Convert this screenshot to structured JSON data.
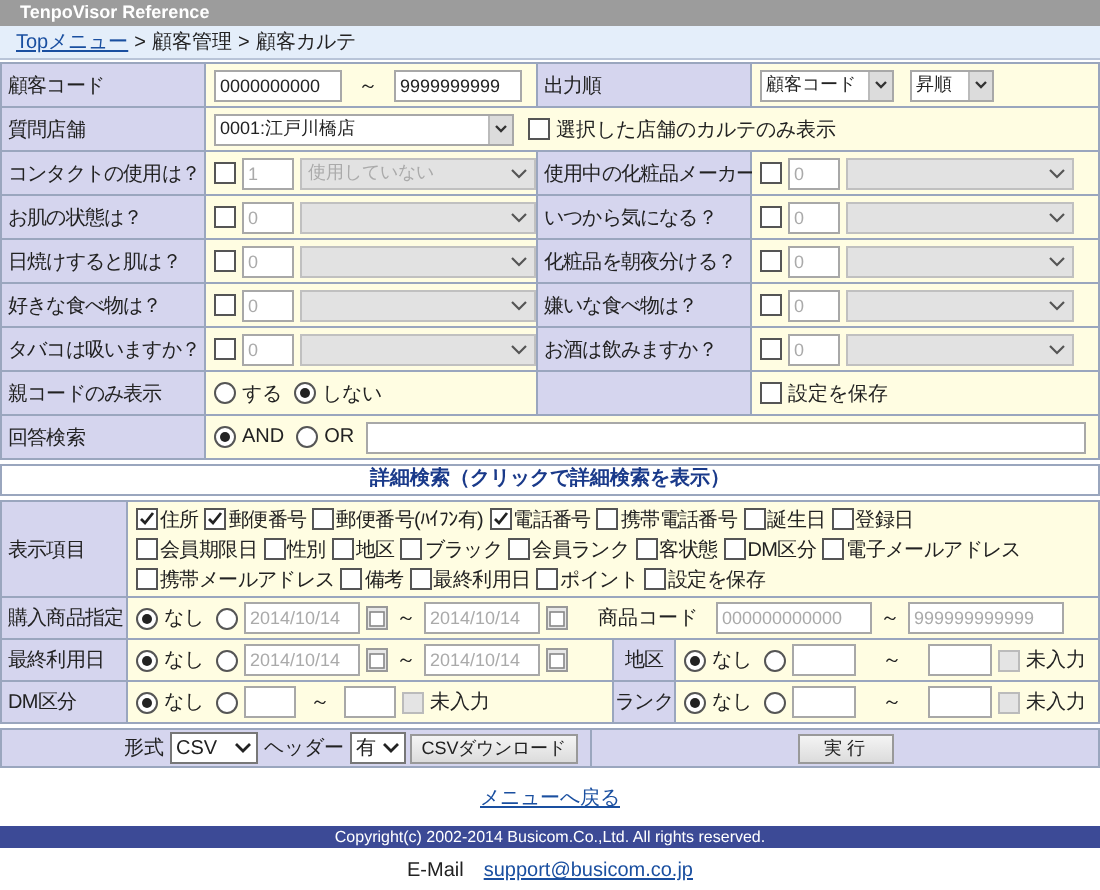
{
  "title": "TenpoVisor Reference",
  "breadcrumb": {
    "separator": ">",
    "items": [
      {
        "text": "Topメニュー",
        "link": true
      },
      {
        "text": "顧客管理",
        "link": false
      },
      {
        "text": "顧客カルテ",
        "link": false
      }
    ]
  },
  "customer_code": {
    "label": "顧客コード",
    "from": "0000000000",
    "tilde": "～",
    "to": "9999999999"
  },
  "output_order": {
    "label": "出力順",
    "sort_key": "顧客コード",
    "direction": "昇順"
  },
  "store": {
    "label": "質問店舗",
    "value": "0001:江戸川橋店",
    "only_selected": {
      "label": "選択した店舗のカルテのみ表示",
      "checked": false
    }
  },
  "questions": [
    {
      "left": {
        "label": "コンタクトの使用は？",
        "checked": false,
        "count": "1",
        "answer": "使用していない"
      },
      "right": {
        "label": "使用中の化粧品メーカー",
        "checked": false,
        "count": "0"
      }
    },
    {
      "left": {
        "label": "お肌の状態は？",
        "checked": false,
        "count": "0"
      },
      "right": {
        "label": "いつから気になる？",
        "checked": false,
        "count": "0"
      }
    },
    {
      "left": {
        "label": "日焼けすると肌は？",
        "checked": false,
        "count": "0"
      },
      "right": {
        "label": "化粧品を朝夜分ける？",
        "checked": false,
        "count": "0"
      }
    },
    {
      "left": {
        "label": "好きな食べ物は？",
        "checked": false,
        "count": "0"
      },
      "right": {
        "label": "嫌いな食べ物は？",
        "checked": false,
        "count": "0"
      }
    },
    {
      "left": {
        "label": "タバコは吸いますか？",
        "checked": false,
        "count": "0"
      },
      "right": {
        "label": "お酒は飲みますか？",
        "checked": false,
        "count": "0"
      }
    }
  ],
  "parent_only": {
    "label": "親コードのみ表示",
    "options": [
      {
        "label": "する",
        "selected": false
      },
      {
        "label": "しない",
        "selected": true
      }
    ]
  },
  "save_settings": {
    "label": "設定を保存",
    "checked": false
  },
  "answer_search": {
    "label": "回答検索",
    "options": [
      {
        "label": "AND",
        "selected": true
      },
      {
        "label": "OR",
        "selected": false
      }
    ]
  },
  "detail_header": "詳細検索（クリックで詳細検索を表示）",
  "display_items": {
    "label": "表示項目",
    "lines": [
      [
        {
          "label": "住所",
          "checked": true
        },
        {
          "label": "郵便番号",
          "checked": true
        },
        {
          "label": "郵便番号(ﾊｲﾌﾝ有)",
          "checked": false
        },
        {
          "label": "電話番号",
          "checked": true
        },
        {
          "label": "携帯電話番号",
          "checked": false
        },
        {
          "label": "誕生日",
          "checked": false
        },
        {
          "label": "登録日",
          "checked": false
        }
      ],
      [
        {
          "label": "会員期限日",
          "checked": false
        },
        {
          "label": "性別",
          "checked": false
        },
        {
          "label": "地区",
          "checked": false
        },
        {
          "label": "ブラック",
          "checked": false
        },
        {
          "label": "会員ランク",
          "checked": false
        },
        {
          "label": "客状態",
          "checked": false
        },
        {
          "label": "DM区分",
          "checked": false
        },
        {
          "label": "電子メールアドレス",
          "checked": false
        }
      ],
      [
        {
          "label": "携帯メールアドレス",
          "checked": false
        },
        {
          "label": "備考",
          "checked": false
        },
        {
          "label": "最終利用日",
          "checked": false
        },
        {
          "label": "ポイント",
          "checked": false
        },
        {
          "label": "設定を保存",
          "checked": false
        }
      ]
    ]
  },
  "purchase": {
    "label": "購入商品指定",
    "options": [
      {
        "label": "なし",
        "selected": true
      },
      {
        "selected": false
      }
    ],
    "from": "2014/10/14",
    "tilde": "～",
    "to": "2014/10/14",
    "code_label": "商品コード",
    "code_from": "000000000000",
    "code_tilde": "～",
    "code_to": "999999999999"
  },
  "last_use": {
    "label": "最終利用日",
    "options": [
      {
        "label": "なし",
        "selected": true
      },
      {
        "selected": false
      }
    ],
    "from": "2014/10/14",
    "tilde": "～",
    "to": "2014/10/14"
  },
  "region": {
    "label": "地区",
    "options": [
      {
        "label": "なし",
        "selected": true
      },
      {
        "selected": false
      }
    ],
    "tilde": "～",
    "unentered": {
      "label": "未入力",
      "checked": false,
      "disabled": true
    }
  },
  "dm": {
    "label": "DM区分",
    "options": [
      {
        "label": "なし",
        "selected": true
      },
      {
        "selected": false
      }
    ],
    "tilde": "～",
    "unentered": {
      "label": "未入力",
      "checked": false,
      "disabled": true
    }
  },
  "rank": {
    "label": "ランク",
    "options": [
      {
        "label": "なし",
        "selected": true
      },
      {
        "selected": false
      }
    ],
    "tilde": "～",
    "unentered": {
      "label": "未入力",
      "checked": false,
      "disabled": true
    }
  },
  "format": {
    "label": "形式",
    "value": "CSV"
  },
  "header": {
    "label": "ヘッダー",
    "value": "有"
  },
  "download_button": "CSVダウンロード",
  "run_button": "実 行",
  "back_link": "メニューへ戻る",
  "copyright": "Copyright(c) 2002-2014 Busicom.Co.,Ltd. All rights reserved.",
  "email_label": "E-Mail",
  "email": "support@busicom.co.jp"
}
